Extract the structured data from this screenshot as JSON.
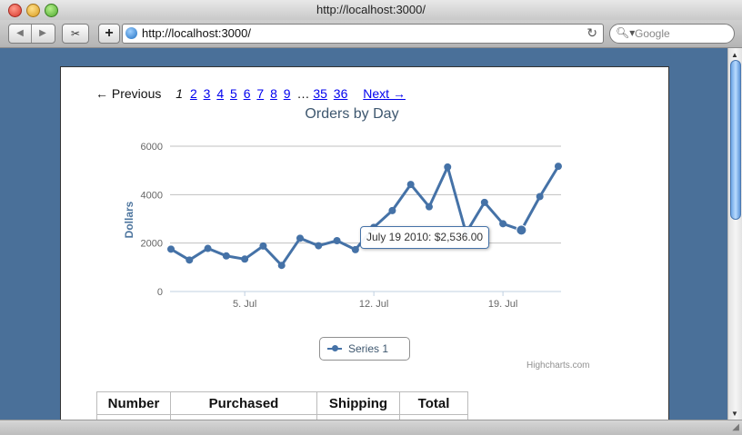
{
  "window": {
    "title": "http://localhost:3000/"
  },
  "toolbar": {
    "url": "http://localhost:3000/",
    "search_placeholder": "Google",
    "add_label": "+",
    "snip_label": "✂"
  },
  "pagination": {
    "previous": "← Previous",
    "current": "1",
    "pages": [
      "2",
      "3",
      "4",
      "5",
      "6",
      "7",
      "8",
      "9"
    ],
    "ellipsis": "…",
    "last_pages": [
      "35",
      "36"
    ],
    "next": "Next →"
  },
  "chart_data": {
    "type": "line",
    "title": "Orders by Day",
    "ylabel": "Dollars",
    "xlabel": "",
    "ylim": [
      0,
      6000
    ],
    "yticks": [
      0,
      2000,
      4000,
      6000
    ],
    "xticks": [
      {
        "label": "5. Jul",
        "day": 5
      },
      {
        "label": "12. Jul",
        "day": 12
      },
      {
        "label": "19. Jul",
        "day": 19
      }
    ],
    "x": [
      1,
      2,
      3,
      4,
      5,
      6,
      7,
      8,
      9,
      10,
      11,
      12,
      13,
      14,
      15,
      16,
      17,
      18,
      19,
      20,
      21,
      22
    ],
    "series": [
      {
        "name": "Series 1",
        "color": "#4572a7",
        "values": [
          1750,
          1300,
          1780,
          1470,
          1340,
          1880,
          1080,
          2200,
          1890,
          2100,
          1730,
          2650,
          3340,
          4420,
          3500,
          5140,
          2420,
          3680,
          2800,
          2536,
          3920,
          5170
        ]
      }
    ],
    "tooltip": {
      "text": "July 19 2010: $2,536.00",
      "highlight_index": 19
    },
    "legend": "bottom-center",
    "grid": true,
    "credits": "Highcharts.com"
  },
  "table": {
    "headers": [
      "Number",
      "Purchased",
      "Shipping",
      "Total"
    ]
  }
}
